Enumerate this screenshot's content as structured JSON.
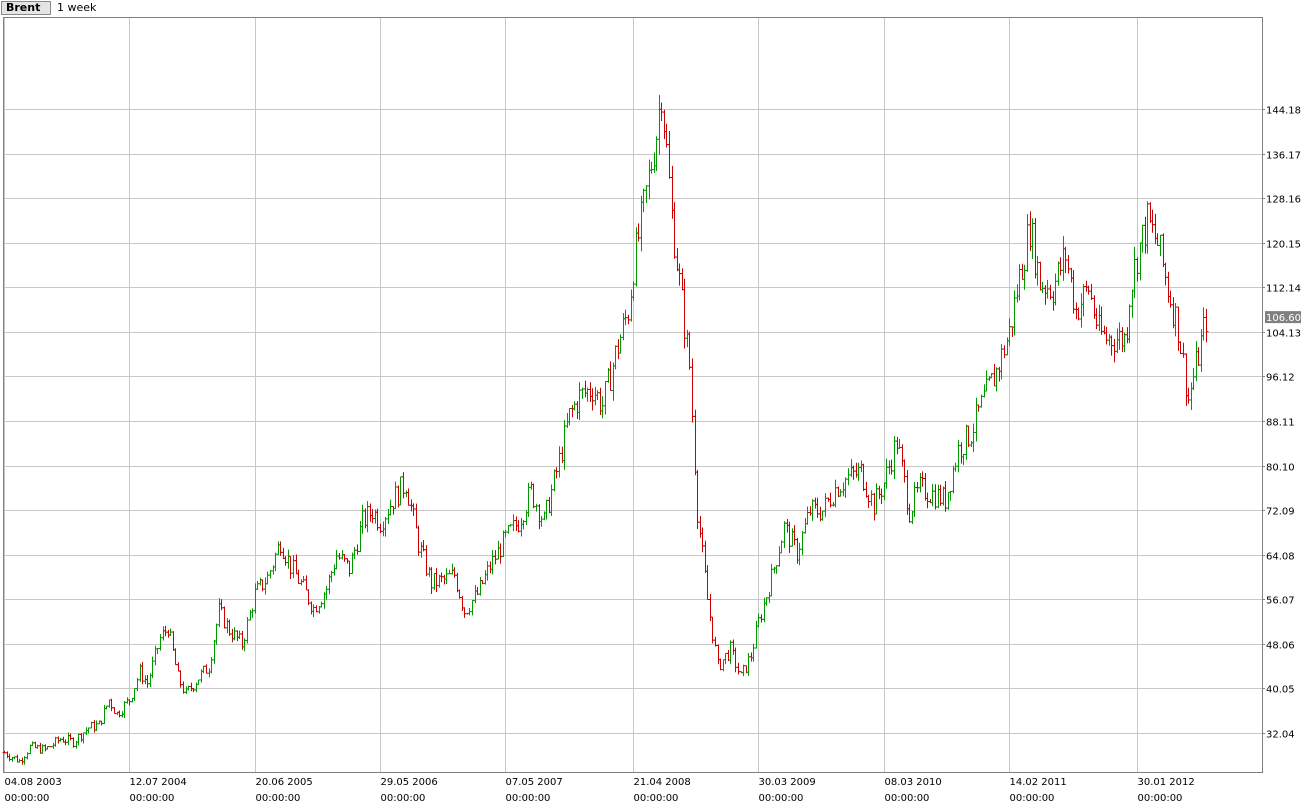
{
  "toolbar": {
    "symbol": "Brent",
    "period": "1 week"
  },
  "chart_data": {
    "type": "ohlc",
    "title": "Brent",
    "interval": "1 week",
    "y_ticks": [
      32.04,
      40.05,
      48.06,
      56.07,
      64.08,
      72.09,
      80.1,
      88.11,
      96.12,
      104.13,
      112.14,
      120.15,
      128.16,
      136.17,
      144.18
    ],
    "y_ticks_text": [
      "32.04",
      "40.05",
      "48.06",
      "56.07",
      "64.08",
      "72.09",
      "80.10",
      "88.11",
      "96.12",
      "104.13",
      "112.14",
      "120.15",
      "128.16",
      "136.17",
      "144.18"
    ],
    "ylim": [
      25.0,
      151.0
    ],
    "x_ticks": [
      {
        "date": "04.08 2003",
        "time": "00:00:00"
      },
      {
        "date": "12.07 2004",
        "time": "00:00:00"
      },
      {
        "date": "20.06 2005",
        "time": "00:00:00"
      },
      {
        "date": "29.05 2006",
        "time": "00:00:00"
      },
      {
        "date": "07.05 2007",
        "time": "00:00:00"
      },
      {
        "date": "21.04 2008",
        "time": "00:00:00"
      },
      {
        "date": "30.03 2009",
        "time": "00:00:00"
      },
      {
        "date": "08.03 2010",
        "time": "00:00:00"
      },
      {
        "date": "14.02 2011",
        "time": "00:00:00"
      },
      {
        "date": "30.01 2012",
        "time": "00:00:00"
      }
    ],
    "last_price": "106.60",
    "last_value": 106.6,
    "grid": true,
    "colors": {
      "up": "#009900",
      "down": "#cc0000",
      "grid": "#c8c8c8",
      "last_price_bg": "#808080"
    },
    "close_path": [
      [
        "04.08 2003",
        28.5
      ],
      [
        "15.09 2003",
        27.0
      ],
      [
        "13.10 2003",
        29.5
      ],
      [
        "24.11 2003",
        29.0
      ],
      [
        "05.01 2004",
        31.0
      ],
      [
        "09.02 2004",
        30.5
      ],
      [
        "22.03 2004",
        33.0
      ],
      [
        "19.04 2004",
        33.5
      ],
      [
        "17.05 2004",
        38.0
      ],
      [
        "07.06 2004",
        35.5
      ],
      [
        "12.07 2004",
        38.0
      ],
      [
        "09.08 2004",
        43.0
      ],
      [
        "30.08 2004",
        41.0
      ],
      [
        "04.10 2004",
        49.0
      ],
      [
        "25.10 2004",
        51.0
      ],
      [
        "22.11 2004",
        42.0
      ],
      [
        "13.12 2004",
        39.0
      ],
      [
        "17.01 2005",
        42.0
      ],
      [
        "14.02 2005",
        44.0
      ],
      [
        "14.03 2005",
        54.0
      ],
      [
        "11.04 2005",
        50.5
      ],
      [
        "16.05 2005",
        48.0
      ],
      [
        "20.06 2005",
        57.0
      ],
      [
        "25.07 2005",
        60.0
      ],
      [
        "29.08 2005",
        66.5
      ],
      [
        "26.09 2005",
        62.0
      ],
      [
        "31.10 2005",
        58.0
      ],
      [
        "28.11 2005",
        54.5
      ],
      [
        "02.01 2006",
        58.0
      ],
      [
        "30.01 2006",
        64.0
      ],
      [
        "06.03 2006",
        61.5
      ],
      [
        "10.04 2006",
        70.0
      ],
      [
        "08.05 2006",
        72.0
      ],
      [
        "29.05 2006",
        70.0
      ],
      [
        "03.07 2006",
        74.0
      ],
      [
        "07.08 2006",
        77.0
      ],
      [
        "11.09 2006",
        66.0
      ],
      [
        "16.10 2006",
        59.0
      ],
      [
        "20.11 2006",
        59.5
      ],
      [
        "18.12 2006",
        60.5
      ],
      [
        "15.01 2007",
        54.0
      ],
      [
        "19.02 2007",
        57.0
      ],
      [
        "26.03 2007",
        62.0
      ],
      [
        "07.05 2007",
        67.0
      ],
      [
        "11.06 2007",
        70.0
      ],
      [
        "16.07 2007",
        75.5
      ],
      [
        "20.08 2007",
        70.0
      ],
      [
        "24.09 2007",
        79.0
      ],
      [
        "29.10 2007",
        89.0
      ],
      [
        "26.11 2007",
        92.5
      ],
      [
        "31.12 2007",
        94.0
      ],
      [
        "28.01 2008",
        91.0
      ],
      [
        "03.03 2008",
        100.0
      ],
      [
        "07.04 2008",
        108.0
      ],
      [
        "21.04 2008",
        116.0
      ],
      [
        "26.05 2008",
        129.0
      ],
      [
        "23.06 2008",
        140.0
      ],
      [
        "07.07 2008",
        148.0
      ],
      [
        "04.08 2008",
        125.0
      ],
      [
        "25.08 2008",
        113.0
      ],
      [
        "22.09 2008",
        98.0
      ],
      [
        "13.10 2008",
        72.0
      ],
      [
        "10.11 2008",
        56.0
      ],
      [
        "08.12 2008",
        44.0
      ],
      [
        "12.01 2009",
        47.0
      ],
      [
        "09.02 2009",
        42.0
      ],
      [
        "09.03 2009",
        46.0
      ],
      [
        "30.03 2009",
        52.0
      ],
      [
        "04.05 2009",
        60.0
      ],
      [
        "08.06 2009",
        69.0
      ],
      [
        "13.07 2009",
        64.5
      ],
      [
        "17.08 2009",
        72.0
      ],
      [
        "21.09 2009",
        72.0
      ],
      [
        "26.10 2009",
        76.0
      ],
      [
        "30.11 2009",
        78.0
      ],
      [
        "04.01 2010",
        79.0
      ],
      [
        "08.02 2010",
        73.0
      ],
      [
        "08.03 2010",
        77.0
      ],
      [
        "12.04 2010",
        84.5
      ],
      [
        "17.05 2010",
        72.0
      ],
      [
        "14.06 2010",
        76.0
      ],
      [
        "19.07 2010",
        75.0
      ],
      [
        "23.08 2010",
        74.0
      ],
      [
        "27.09 2010",
        83.0
      ],
      [
        "01.11 2010",
        86.0
      ],
      [
        "06.12 2010",
        92.0
      ],
      [
        "10.01 2011",
        97.0
      ],
      [
        "14.02 2011",
        104.0
      ],
      [
        "14.03 2011",
        114.0
      ],
      [
        "11.04 2011",
        123.0
      ],
      [
        "09.05 2011",
        113.0
      ],
      [
        "13.06 2011",
        112.0
      ],
      [
        "18.07 2011",
        118.0
      ],
      [
        "15.08 2011",
        108.0
      ],
      [
        "19.09 2011",
        112.0
      ],
      [
        "17.10 2011",
        104.0
      ],
      [
        "07.11 2011",
        103.0
      ],
      [
        "30.12 2011",
        103.0
      ],
      [
        "09.01 2012",
        111.0
      ],
      [
        "30.01 2012",
        118.0
      ],
      [
        "27.02 2012",
        124.0
      ],
      [
        "26.03 2012",
        120.0
      ],
      [
        "23.04 2012",
        112.0
      ],
      [
        "21.05 2012",
        105.0
      ],
      [
        "18.06 2012",
        92.0
      ],
      [
        "16.07 2012",
        100.0
      ],
      [
        "06.08 2012",
        106.6
      ]
    ]
  }
}
